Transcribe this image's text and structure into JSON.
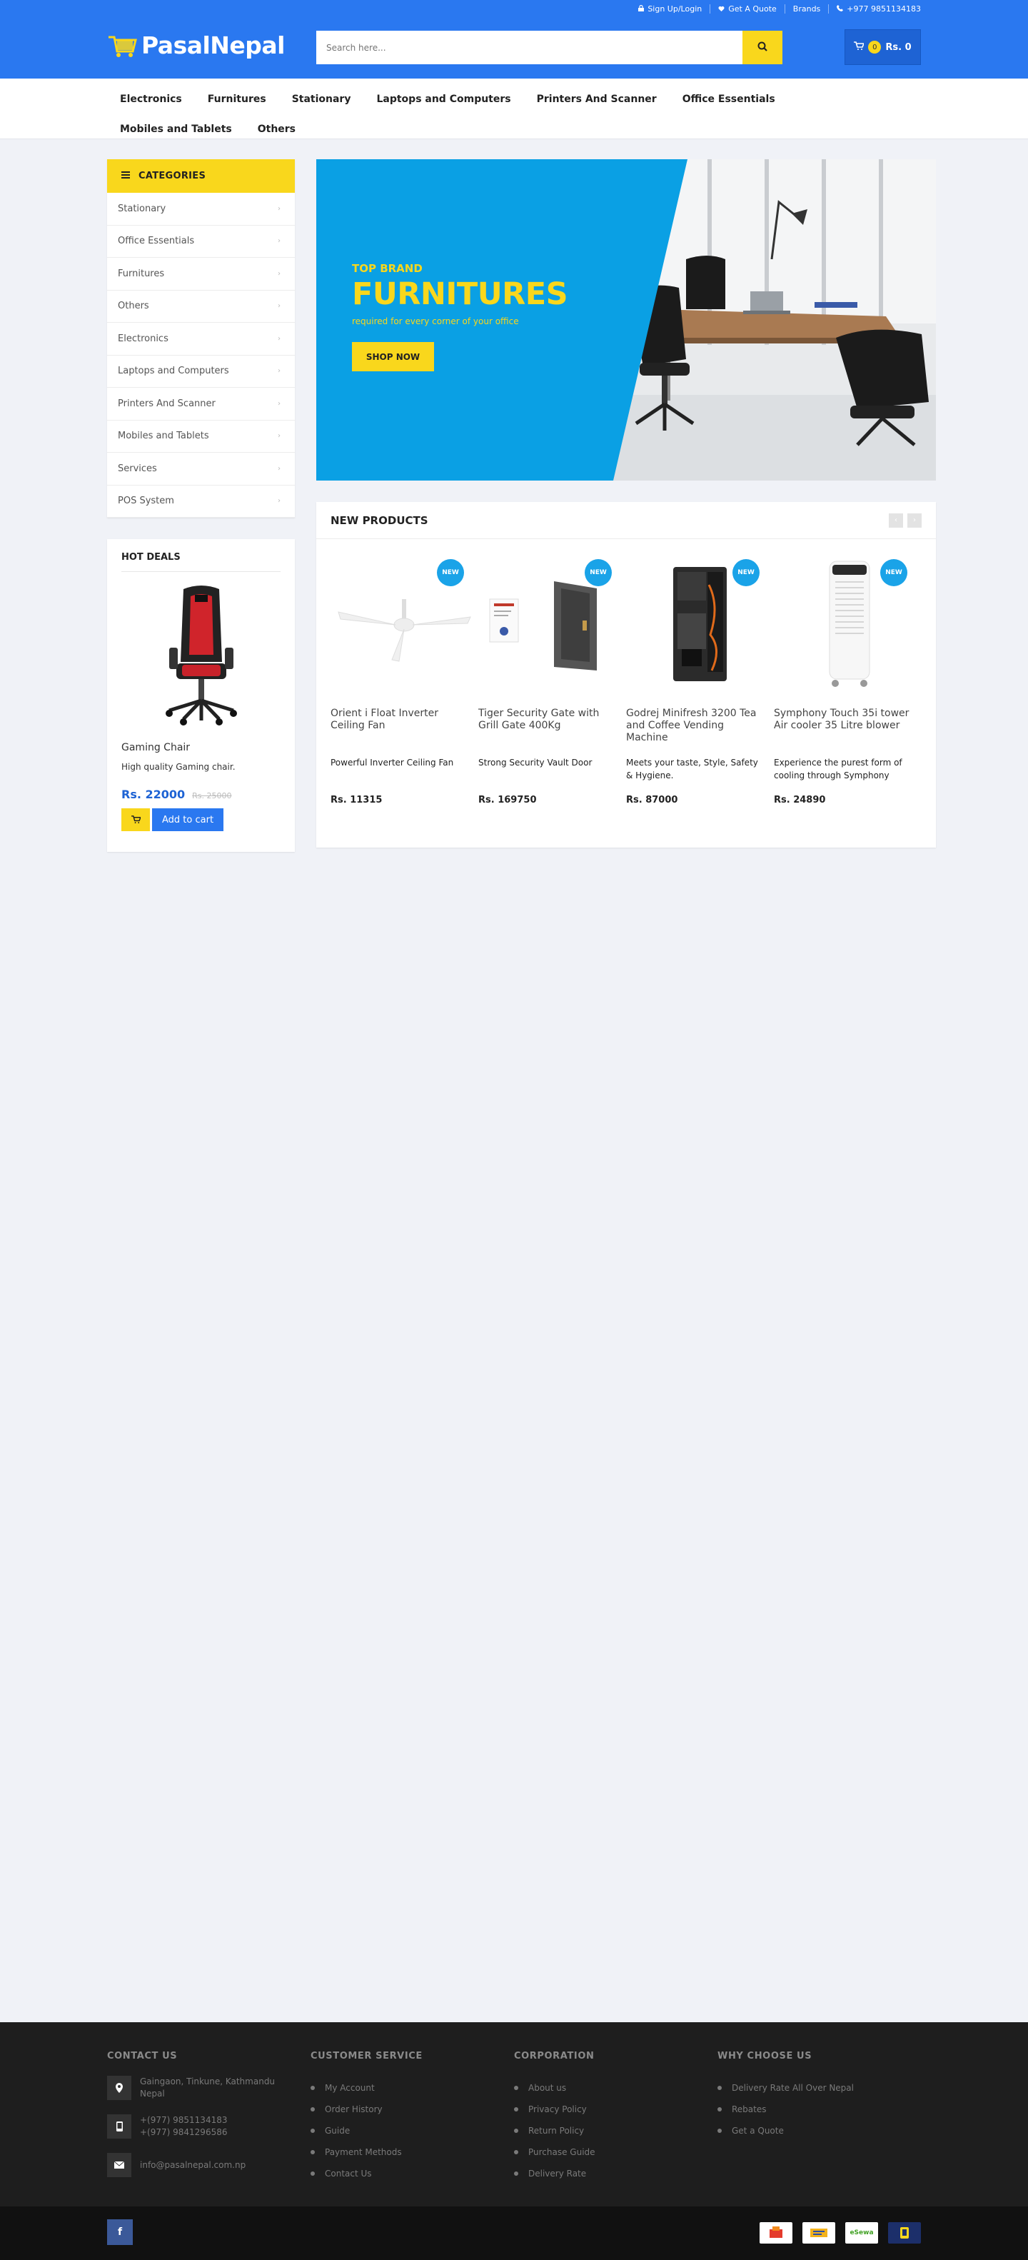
{
  "header": {
    "links": [
      "Sign Up/Login",
      "Get A Quote",
      "Brands",
      "+977 9851134183"
    ],
    "logo_text": "PasalNepal",
    "search_placeholder": "Search here...",
    "cart_count": "0",
    "cart_total": "Rs. 0"
  },
  "nav": [
    "Electronics",
    "Furnitures",
    "Stationary",
    "Laptops and Computers",
    "Printers And Scanner",
    "Office Essentials",
    "Mobiles and Tablets",
    "Others"
  ],
  "categories": {
    "title": "CATEGORIES",
    "items": [
      "Stationary",
      "Office Essentials",
      "Furnitures",
      "Others",
      "Electronics",
      "Laptops and Computers",
      "Printers And Scanner",
      "Mobiles and Tablets",
      "Services",
      "POS System"
    ]
  },
  "hot_deals": {
    "title": "HOT DEALS",
    "name": "Gaming Chair",
    "desc": "High quality Gaming chair.",
    "price": "Rs. 22000",
    "old_price": "Rs. 25000",
    "cart_label": "Add to cart"
  },
  "banner": {
    "tag": "TOP BRAND",
    "title": "FURNITURES",
    "subtitle": "required for every corner of your office",
    "button": "SHOP NOW"
  },
  "new_products": {
    "title": "NEW PRODUCTS",
    "badge": "NEW",
    "items": [
      {
        "name": "Orient i Float Inverter Ceiling Fan",
        "desc": "Powerful Inverter Ceiling Fan",
        "price": "Rs. 11315"
      },
      {
        "name": "Tiger Security Gate with Grill Gate 400Kg",
        "desc": "Strong Security Vault Door",
        "price": "Rs. 169750"
      },
      {
        "name": "Godrej Minifresh 3200 Tea and Coffee Vending Machine",
        "desc": "Meets your taste, Style, Safety & Hygiene.",
        "price": "Rs. 87000"
      },
      {
        "name": "Symphony Touch 35i tower Air cooler 35 Litre blower",
        "desc": "Experience the purest form of cooling through Symphony",
        "price": "Rs. 24890"
      }
    ]
  },
  "footer": {
    "contact": {
      "title": "CONTACT US",
      "address": "Gaingaon, Tinkune, Kathmandu Nepal",
      "phone1": "+(977) 9851134183",
      "phone2": "+(977) 9841296586",
      "email": "info@pasalnepal.com.np"
    },
    "customer_service": {
      "title": "CUSTOMER SERVICE",
      "items": [
        "My Account",
        "Order History",
        "Guide",
        "Payment Methods",
        "Contact Us"
      ]
    },
    "corporation": {
      "title": "CORPORATION",
      "items": [
        "About us",
        "Privacy Policy",
        "Return Policy",
        "Purchase Guide",
        "Delivery Rate"
      ]
    },
    "why": {
      "title": "WHY CHOOSE US",
      "items": [
        "Delivery Rate All Over Nepal",
        "Rebates",
        "Get a Quote"
      ]
    },
    "social": "f",
    "payments": [
      "",
      "",
      "eSewa",
      ""
    ]
  }
}
